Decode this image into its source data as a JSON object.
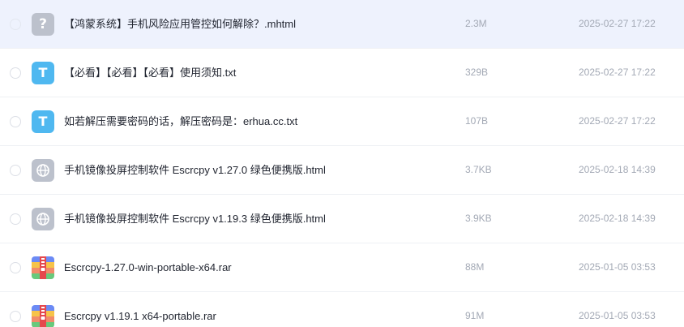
{
  "files": [
    {
      "name": "【鸿蒙系统】手机风险应用管控如何解除？.mhtml",
      "size": "2.3M",
      "date": "2025-02-27 17:22",
      "icon": "unknown-file-icon",
      "selected": true
    },
    {
      "name": "【必看】【必看】【必看】使用须知.txt",
      "size": "329B",
      "date": "2025-02-27 17:22",
      "icon": "txt-file-icon",
      "selected": false
    },
    {
      "name": "如若解压需要密码的话，解压密码是：erhua.cc.txt",
      "size": "107B",
      "date": "2025-02-27 17:22",
      "icon": "txt-file-icon",
      "selected": false
    },
    {
      "name": "手机镜像投屏控制软件 Escrcpy v1.27.0 绿色便携版.html",
      "size": "3.7KB",
      "date": "2025-02-18 14:39",
      "icon": "web-file-icon",
      "selected": false
    },
    {
      "name": "手机镜像投屏控制软件 Escrcpy v1.19.3 绿色便携版.html",
      "size": "3.9KB",
      "date": "2025-02-18 14:39",
      "icon": "web-file-icon",
      "selected": false
    },
    {
      "name": "Escrcpy-1.27.0-win-portable-x64.rar",
      "size": "88M",
      "date": "2025-01-05 03:53",
      "icon": "rar-archive-icon",
      "selected": false
    },
    {
      "name": "Escrcpy v1.19.1 x64-portable.rar",
      "size": "91M",
      "date": "2025-01-05 03:53",
      "icon": "rar-archive-icon",
      "selected": false
    }
  ],
  "icon_glyphs": {
    "unknown": "?",
    "txt": "T"
  },
  "colors": {
    "selected_row": "#eef2fd",
    "txt_icon": "#4fb8f0",
    "gray_icon": "#bcc1cc"
  }
}
